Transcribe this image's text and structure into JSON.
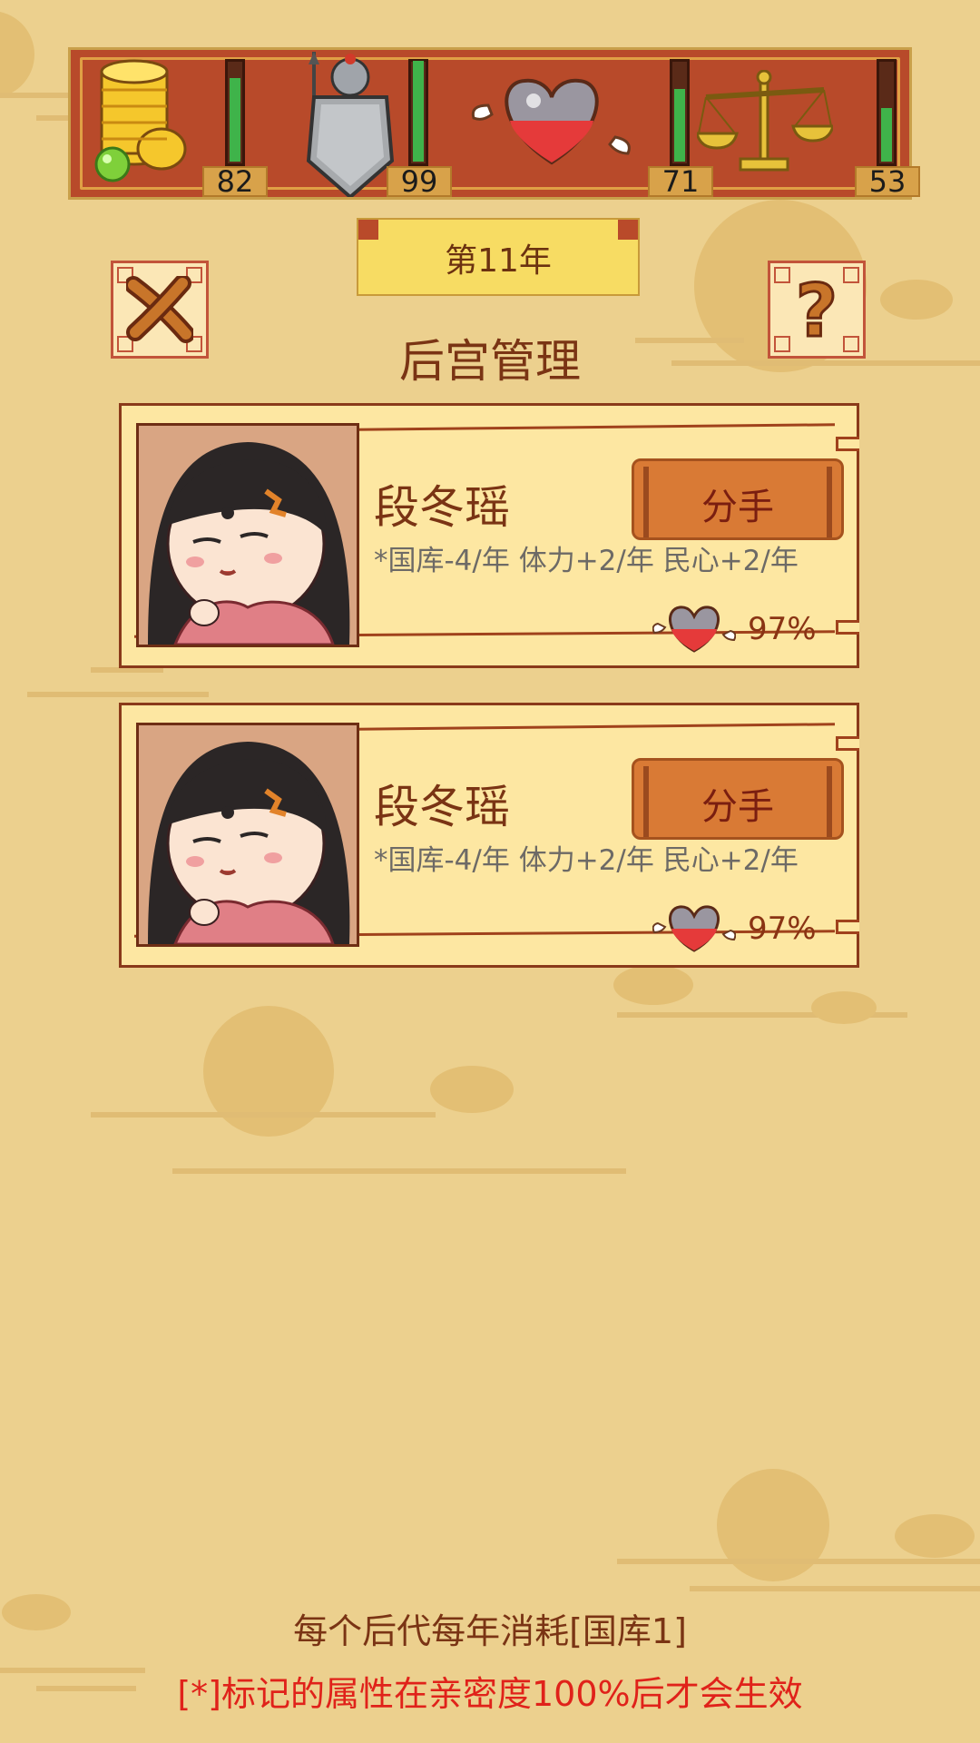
{
  "stats": [
    {
      "name": "national-treasury",
      "icon": "gold-coins-icon",
      "value": "82",
      "level": 0.82
    },
    {
      "name": "military-strength",
      "icon": "knight-shield-icon",
      "value": "99",
      "level": 0.99
    },
    {
      "name": "stamina",
      "icon": "winged-heart-potion-icon",
      "value": "71",
      "level": 0.71
    },
    {
      "name": "public-support",
      "icon": "balance-scale-icon",
      "value": "53",
      "level": 0.53
    }
  ],
  "year_label": "第11年",
  "close_icon": "close-x-icon",
  "help_icon": "question-mark-icon",
  "help_label": "?",
  "page_title": "后宫管理",
  "consorts": [
    {
      "name": "段冬瑶",
      "attrs": "*国库-4/年 体力+2/年 民心+2/年",
      "button_label": "分手",
      "affinity": "97%"
    },
    {
      "name": "段冬瑶",
      "attrs": "*国库-4/年 体力+2/年 民心+2/年",
      "button_label": "分手",
      "affinity": "97%"
    }
  ],
  "footer": {
    "note_upkeep": "每个后代每年消耗[国库1]",
    "note_effect": "[*]标记的属性在亲密度100%后才会生效"
  },
  "colors": {
    "background": "#ecd08e",
    "stats_bar": "#b84a2a",
    "meter_fill": "#3fb34a",
    "accent_text": "#7a3414",
    "warning_text": "#e0221a"
  }
}
